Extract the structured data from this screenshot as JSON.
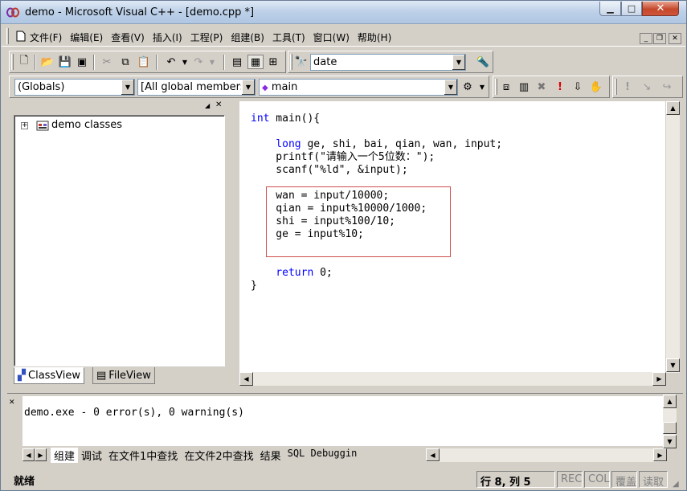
{
  "window": {
    "title": "demo - Microsoft Visual C++ - [demo.cpp *]"
  },
  "menubar": {
    "items": [
      "文件(F)",
      "编辑(E)",
      "查看(V)",
      "插入(I)",
      "工程(P)",
      "组建(B)",
      "工具(T)",
      "窗口(W)",
      "帮助(H)"
    ]
  },
  "toolbar": {
    "find_combo": "date",
    "globals_combo": "(Globals)",
    "members_combo": "[All global members",
    "function_combo": "main"
  },
  "classview": {
    "root": "demo classes",
    "tabs": [
      "ClassView",
      "FileView"
    ]
  },
  "editor": {
    "lines": [
      {
        "kw": "int",
        "rest": " main(){"
      },
      {
        "kw": "",
        "rest": ""
      },
      {
        "kw": "    long",
        "rest": " ge, shi, bai, qian, wan, input;"
      },
      {
        "kw": "",
        "rest": "    printf(\"请输入一个5位数：\");"
      },
      {
        "kw": "",
        "rest": "    scanf(\"%ld\", &input);"
      },
      {
        "kw": "",
        "rest": ""
      },
      {
        "kw": "",
        "rest": "    wan = input/10000;"
      },
      {
        "kw": "",
        "rest": "    qian = input%10000/1000;"
      },
      {
        "kw": "",
        "rest": "    shi = input%100/10;"
      },
      {
        "kw": "",
        "rest": "    ge = input%10;"
      },
      {
        "kw": "",
        "rest": ""
      },
      {
        "kw": "",
        "rest": ""
      },
      {
        "kw": "    return",
        "rest": " 0;"
      },
      {
        "kw": "",
        "rest": "}"
      }
    ]
  },
  "output": {
    "text": "demo.exe - 0 error(s), 0 warning(s)",
    "tabs": [
      "组建",
      "调试",
      "在文件1中查找",
      "在文件2中查找",
      "结果",
      "SQL Debuggin"
    ]
  },
  "status": {
    "ready": "就绪",
    "position": "行 8, 列 5",
    "rec": "REC",
    "col": "COL",
    "ovr": "覆盖",
    "read": "读取"
  },
  "colors": {
    "keyword": "#0000ff",
    "highlight_box": "#d05050"
  }
}
